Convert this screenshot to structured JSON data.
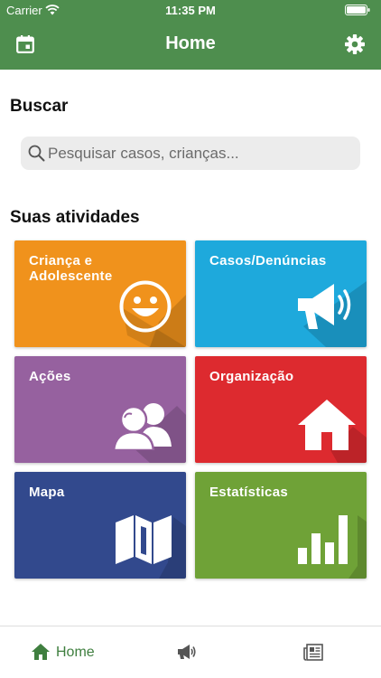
{
  "status_bar": {
    "carrier": "Carrier",
    "time": "11:35 PM"
  },
  "header": {
    "title": "Home",
    "left_icon": "calendar-icon",
    "right_icon": "gear-icon"
  },
  "search": {
    "title": "Buscar",
    "placeholder": "Pesquisar casos, crianças...",
    "value": ""
  },
  "activities": {
    "title": "Suas atividades",
    "tiles": [
      {
        "label": "Criança e Adolescente",
        "icon": "smiley-icon",
        "color": "#f0921c"
      },
      {
        "label": "Casos/Denúncias",
        "icon": "megaphone-icon",
        "color": "#1ea9dc"
      },
      {
        "label": "Ações",
        "icon": "people-icon",
        "color": "#96619f"
      },
      {
        "label": "Organização",
        "icon": "house-icon",
        "color": "#dd2a2f"
      },
      {
        "label": "Mapa",
        "icon": "map-icon",
        "color": "#32498d"
      },
      {
        "label": "Estatísticas",
        "icon": "bar-chart-icon",
        "color": "#6fa237"
      }
    ]
  },
  "tab_bar": {
    "home_label": "Home",
    "active_color": "#3f7f3f",
    "icons": [
      "home-icon",
      "megaphone-icon",
      "newspaper-icon"
    ]
  }
}
